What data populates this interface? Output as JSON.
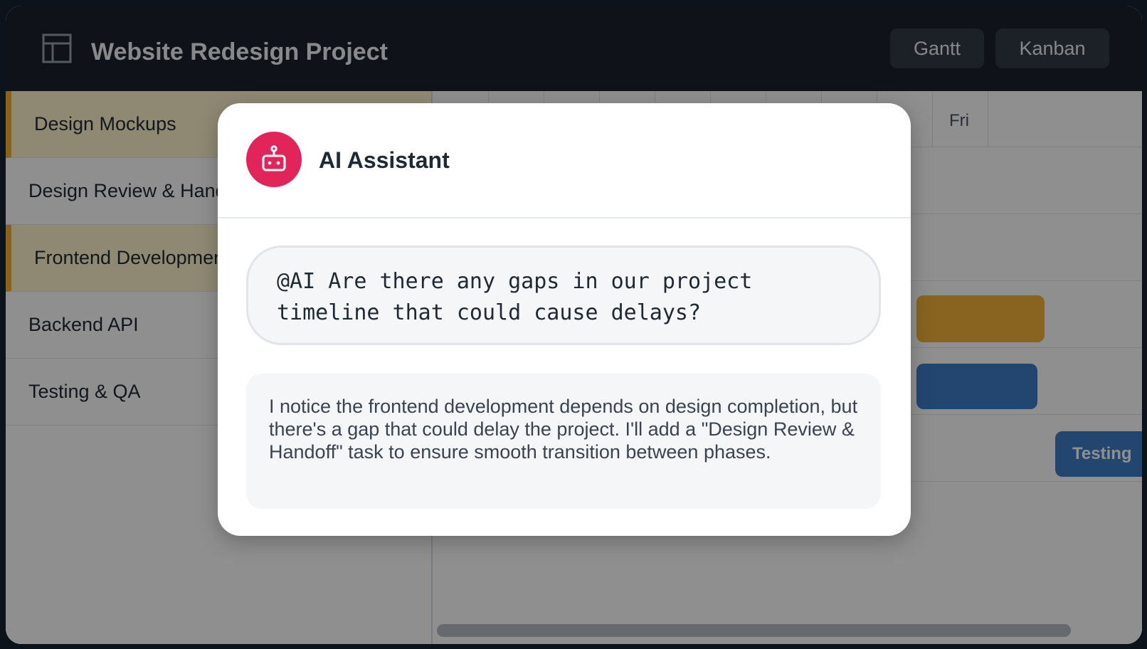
{
  "header": {
    "logo_icon": "layout-icon",
    "title": "Website Redesign Project",
    "views": [
      "Gantt",
      "Kanban"
    ]
  },
  "tasks": [
    {
      "name": "Design Mockups",
      "highlighted": true
    },
    {
      "name": "Design Review & Handoff",
      "highlighted": false
    },
    {
      "name": "Frontend Development",
      "highlighted": true
    },
    {
      "name": "Backend API",
      "highlighted": false
    },
    {
      "name": "Testing & QA",
      "highlighted": false
    }
  ],
  "timeline": {
    "visible_day_label": "Fri",
    "testing_bar_label": "Testing",
    "colors": {
      "yellow": "#f2b33a",
      "blue": "#3f7ec9"
    }
  },
  "modal": {
    "avatar_icon": "robot-icon",
    "title": "AI Assistant",
    "prompt": "@AI Are there any gaps in our project timeline that could cause delays?",
    "response": "I notice the frontend development depends on design completion, but there's a gap that could delay the project. I'll add a \"Design Review & Handoff\" task to ensure smooth transition between phases.",
    "accent": "#e2245a"
  }
}
